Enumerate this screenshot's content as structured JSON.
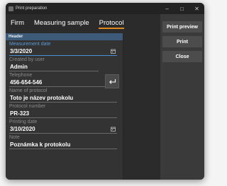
{
  "window": {
    "title": "Print preparation",
    "minimize_glyph": "–",
    "maximize_glyph": "□",
    "close_glyph": "✕"
  },
  "tabs": [
    {
      "label": "Firm",
      "active": false
    },
    {
      "label": "Measuring sample",
      "active": false
    },
    {
      "label": "Protocol",
      "active": true
    }
  ],
  "actions": {
    "print_preview": "Print preview",
    "print": "Print",
    "close": "Close"
  },
  "form": {
    "section_header": "Header",
    "measurement_date": {
      "label": "Measurement date",
      "value": "3/3/2020"
    },
    "created_by": {
      "label": "Created by user",
      "value": "Admin"
    },
    "telephone": {
      "label": "Telephone",
      "value": "456-654-546"
    },
    "protocol_name": {
      "label": "Name of protocol",
      "value": "Toto je název protokolu"
    },
    "protocol_number": {
      "label": "Protocol number",
      "value": "PR-323"
    },
    "printing_date": {
      "label": "Printing date",
      "value": "3/10/2020"
    },
    "note": {
      "label": "Note",
      "value": "Poznámka k protokolu"
    }
  },
  "colors": {
    "accent_tab": "#e08a1e",
    "header_bar": "#3d5a78",
    "focus_label": "#5a9ad6"
  },
  "icons": {
    "calendar": "calendar-icon",
    "enter": "enter-arrow-icon"
  }
}
